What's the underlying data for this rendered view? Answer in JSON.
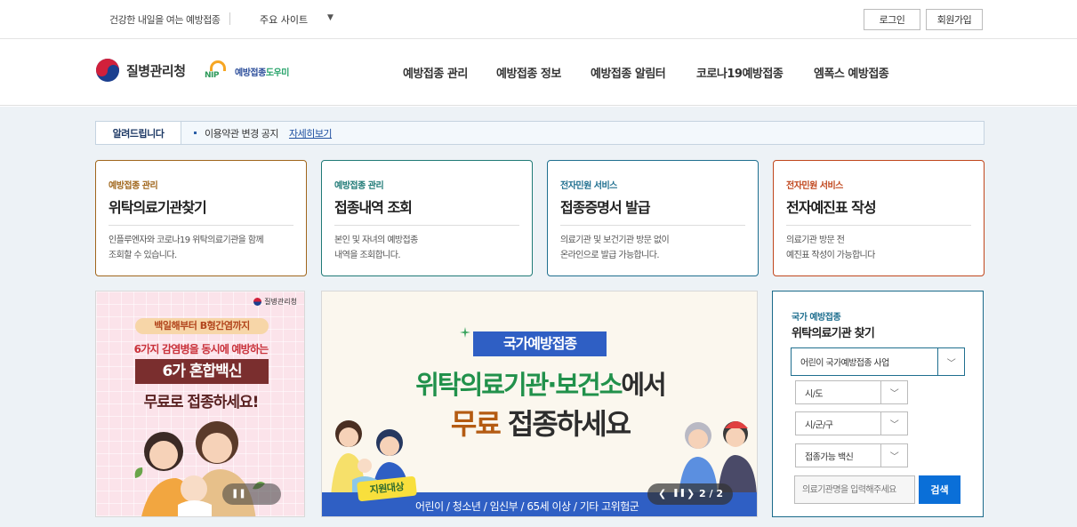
{
  "topbar": {
    "tagline": "건강한 내일을 여는 예방접종",
    "sites_label": "주요 사이트",
    "login": "로그인",
    "join": "회원가입"
  },
  "header": {
    "agency_name": "질병관리청",
    "nip_mark": "NIP",
    "nip_label_main": "예방접종",
    "nip_label_accent": "도우미",
    "gnb": [
      "예방접종 관리",
      "예방접종 정보",
      "예방접종 알림터",
      "코로나19예방접종",
      "엠폭스 예방접종"
    ]
  },
  "notice": {
    "label": "알려드립니다",
    "message": "이용약관 변경 공지",
    "more": "자세히보기"
  },
  "cards": [
    {
      "category": "예방접종 관리",
      "title": "위탁의료기관찾기",
      "desc1": "인플루엔자와 코로나19 위탁의료기관을 함께",
      "desc2": "조회할 수 있습니다.",
      "color": "#a0661c"
    },
    {
      "category": "예방접종 관리",
      "title": "접종내역 조회",
      "desc1": "본인 및 자녀의 예방접종",
      "desc2": "내역을 조회합니다.",
      "color": "#1f7a76"
    },
    {
      "category": "전자민원 서비스",
      "title": "접종증명서 발급",
      "desc1": "의료기관 및 보건기관 방문 없이",
      "desc2": "온라인으로 발급 가능합니다.",
      "color": "#1f6f8f"
    },
    {
      "category": "전자민원 서비스",
      "title": "전자예진표 작성",
      "desc1": "의료기관 방문 전",
      "desc2": "예진표 작성이 가능합니다",
      "color": "#c0461c"
    }
  ],
  "banner_left": {
    "brand": "질병관리청",
    "line1": "백일해부터 B형간염까지",
    "line2": "6가지 감염병을 동시에 예방하는",
    "line3": "6가 혼합백신",
    "line4": "무료로 접종하세요!"
  },
  "banner_mid": {
    "tag": "국가예방접종",
    "head1_a": "위탁의료기관·보건소",
    "head1_b": "에서",
    "head2_a": "무료",
    "head2_b": " 접종하세요",
    "target": "지원대상",
    "list": "어린이 / 청소년 / 임신부 / 65세 이상 / 기타 고위험군",
    "page": "2 / 2"
  },
  "search": {
    "category": "국가 예방접종",
    "title": "위탁의료기관 찾기",
    "program": "어린이 국가예방접종 사업",
    "sido": "시/도",
    "sigungu": "시/군/구",
    "vaccine": "접종가능 백신",
    "placeholder": "의료기관명을 입력해주세요",
    "button": "검색"
  }
}
